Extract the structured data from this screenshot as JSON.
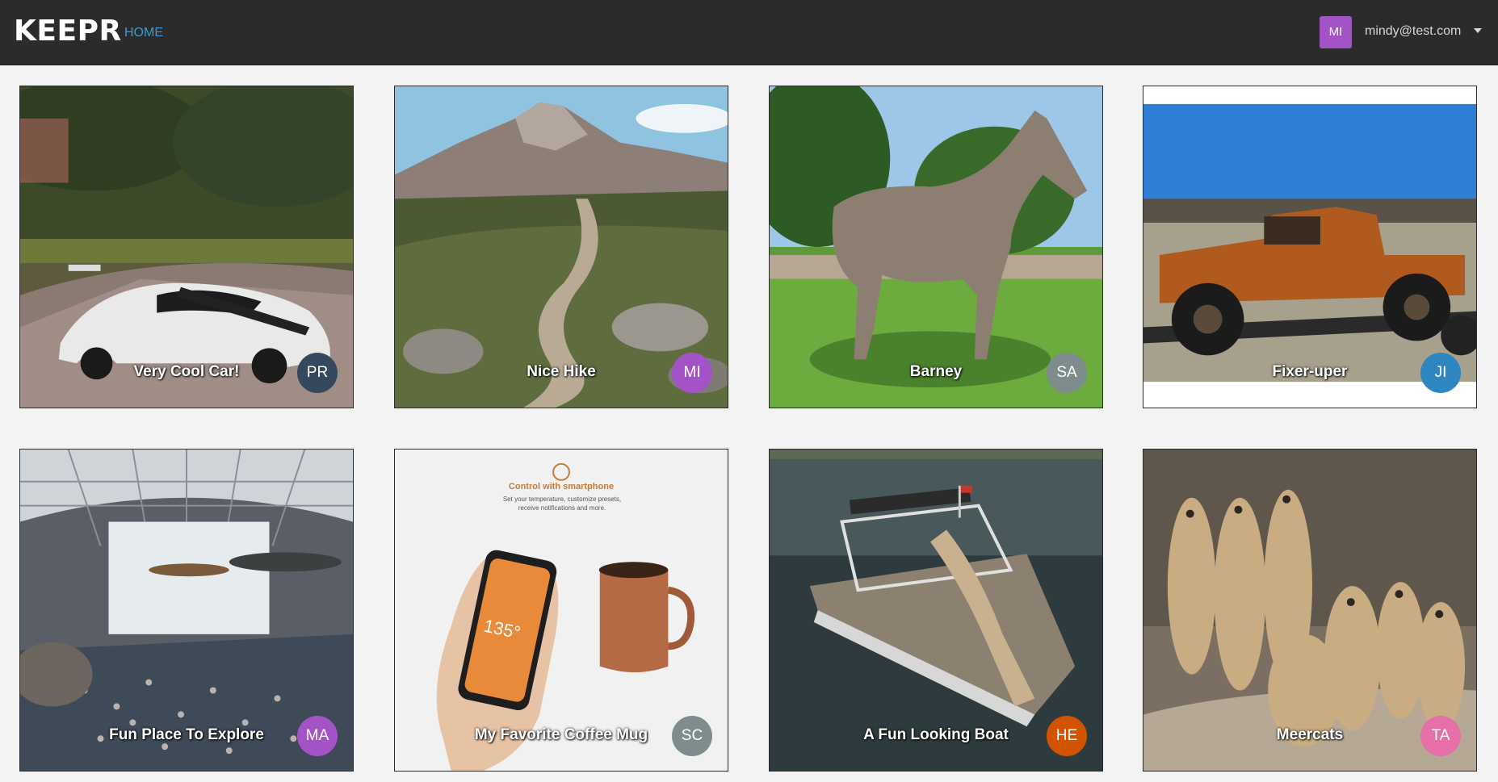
{
  "navbar": {
    "brand": "KEEPR",
    "home_link": "HOME",
    "user": {
      "initials": "MI",
      "email": "mindy@test.com",
      "avatar_color": "#a453c7"
    }
  },
  "keeps": [
    {
      "title": "Very Cool Car!",
      "creator_initials": "PR",
      "avatar_color": "#34495e",
      "image": "white sports car in tree-lined drive"
    },
    {
      "title": "Nice Hike",
      "creator_initials": "MI",
      "avatar_color": "#a453c7",
      "image": "mountain trail"
    },
    {
      "title": "Barney",
      "creator_initials": "SA",
      "avatar_color": "#7f8c8d",
      "image": "grey horse on lawn"
    },
    {
      "title": "Fixer-uper",
      "creator_initials": "JI",
      "avatar_color": "#2e86c1",
      "image": "rusty old truck on trailer"
    },
    {
      "title": "Fun Place To Explore",
      "creator_initials": "MA",
      "avatar_color": "#a453c7",
      "image": "air and space museum hall"
    },
    {
      "title": "My Favorite Coffee Mug",
      "creator_initials": "SC",
      "avatar_color": "#7f8c8d",
      "image": "smart coffee mug and phone app"
    },
    {
      "title": "A Fun Looking Boat",
      "creator_initials": "HE",
      "avatar_color": "#d35400",
      "image": "pontoon boat with slide"
    },
    {
      "title": "Meercats",
      "creator_initials": "TA",
      "avatar_color": "#e76fa7",
      "image": "group of meerkats on rock"
    }
  ],
  "mug_ad": {
    "headline": "Control with smartphone",
    "subline": "Set your temperature, customize presets, receive notifications and more.",
    "temperature": "135°"
  }
}
